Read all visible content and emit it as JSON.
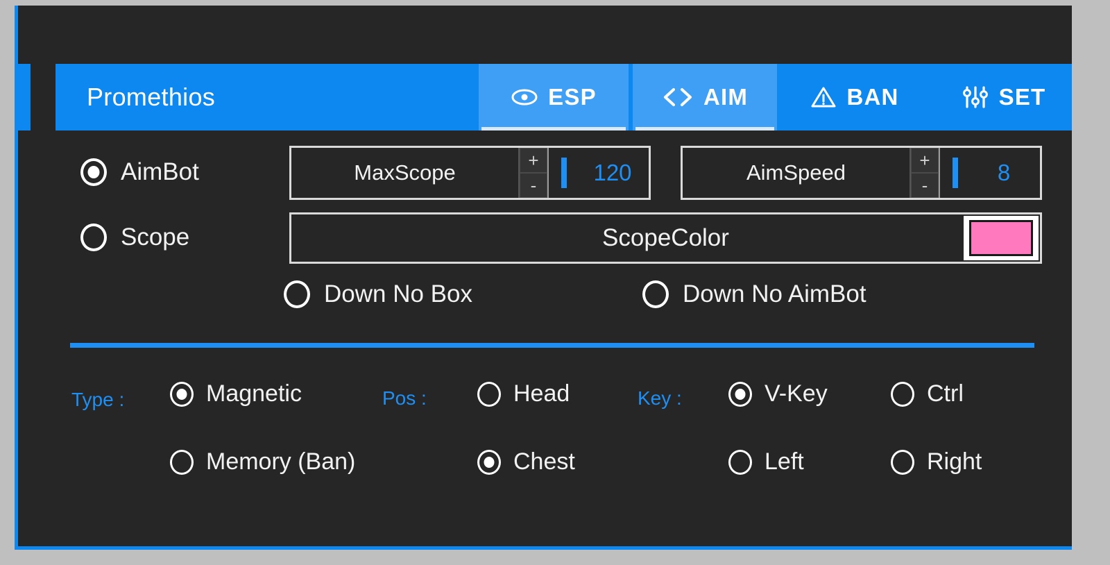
{
  "app": {
    "title": "Promethios",
    "accent_color": "#0d88f0",
    "panel_bg": "#262626",
    "desktop_bg": "#bfbfbf"
  },
  "tabs": [
    {
      "id": "esp",
      "label": "ESP",
      "icon": "eye-icon",
      "active": true
    },
    {
      "id": "aim",
      "label": "AIM",
      "icon": "code-icon",
      "active": true
    },
    {
      "id": "ban",
      "label": "BAN",
      "icon": "warning-icon",
      "active": false
    },
    {
      "id": "set",
      "label": "SET",
      "icon": "sliders-icon",
      "active": false
    }
  ],
  "aim_panel": {
    "aimbot": {
      "label": "AimBot",
      "checked": true
    },
    "scope": {
      "label": "Scope",
      "checked": false
    },
    "maxscope": {
      "label": "MaxScope",
      "value": "120",
      "increment_label": "+",
      "decrement_label": "-"
    },
    "aimspeed": {
      "label": "AimSpeed",
      "value": "8",
      "increment_label": "+",
      "decrement_label": "-"
    },
    "scope_color": {
      "label": "ScopeColor",
      "swatch_color": "#ff79bf"
    },
    "down_no_box": {
      "label": "Down No Box",
      "checked": false
    },
    "down_no_aimbot": {
      "label": "Down No AimBot",
      "checked": false
    },
    "groups": {
      "type": {
        "label": "Type :",
        "options": [
          {
            "label": "Magnetic",
            "checked": true
          },
          {
            "label": "Memory (Ban)",
            "checked": false
          }
        ]
      },
      "pos": {
        "label": "Pos :",
        "options": [
          {
            "label": "Head",
            "checked": false
          },
          {
            "label": "Chest",
            "checked": true
          }
        ]
      },
      "key": {
        "label": "Key :",
        "options": [
          {
            "label": "V-Key",
            "checked": true
          },
          {
            "label": "Ctrl",
            "checked": false
          },
          {
            "label": "Left",
            "checked": false
          },
          {
            "label": "Right",
            "checked": false
          }
        ]
      }
    }
  }
}
